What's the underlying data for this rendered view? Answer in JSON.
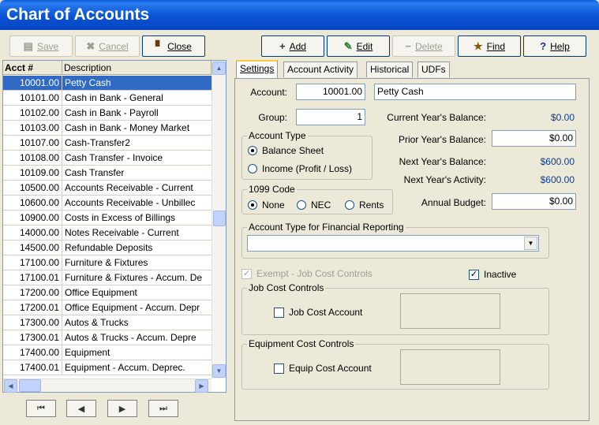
{
  "window": {
    "title": "Chart of Accounts"
  },
  "toolbar": {
    "save": "Save",
    "cancel": "Cancel",
    "close": "Close",
    "add": "Add",
    "edit": "Edit",
    "delete": "Delete",
    "find": "Find",
    "help": "Help"
  },
  "list": {
    "headers": [
      "Acct #",
      "Description"
    ],
    "rows": [
      {
        "acct": "10001.00",
        "desc": "Petty Cash"
      },
      {
        "acct": "10101.00",
        "desc": "Cash in Bank - General"
      },
      {
        "acct": "10102.00",
        "desc": "Cash in Bank - Payroll"
      },
      {
        "acct": "10103.00",
        "desc": "Cash in Bank - Money Market"
      },
      {
        "acct": "10107.00",
        "desc": "Cash-Transfer2"
      },
      {
        "acct": "10108.00",
        "desc": "Cash Transfer - Invoice"
      },
      {
        "acct": "10109.00",
        "desc": " Cash Transfer"
      },
      {
        "acct": "10500.00",
        "desc": "Accounts Receivable - Current"
      },
      {
        "acct": "10600.00",
        "desc": "Accounts Receivable - Unbillec"
      },
      {
        "acct": "10900.00",
        "desc": "Costs in Excess of Billings"
      },
      {
        "acct": "14000.00",
        "desc": "Notes Receivable - Current"
      },
      {
        "acct": "14500.00",
        "desc": "Refundable Deposits"
      },
      {
        "acct": "17100.00",
        "desc": "Furniture & Fixtures"
      },
      {
        "acct": "17100.01",
        "desc": "Furniture & Fixtures - Accum. De"
      },
      {
        "acct": "17200.00",
        "desc": "Office Equipment"
      },
      {
        "acct": "17200.01",
        "desc": "Office Equipment - Accum. Depr"
      },
      {
        "acct": "17300.00",
        "desc": "Autos & Trucks"
      },
      {
        "acct": "17300.01",
        "desc": "Autos & Trucks - Accum. Depre"
      },
      {
        "acct": "17400.00",
        "desc": "Equipment"
      },
      {
        "acct": "17400.01",
        "desc": "Equipment - Accum. Deprec."
      }
    ],
    "selected_index": 0
  },
  "tabs": [
    "Settings",
    "Account Activity",
    "Historical",
    "UDFs"
  ],
  "settings": {
    "account_label": "Account:",
    "account_number": "10001.00",
    "account_name": "Petty Cash",
    "group_label": "Group:",
    "group_value": "1",
    "current_year_label": "Current Year's Balance:",
    "current_year_value": "$0.00",
    "prior_year_label": "Prior Year's Balance:",
    "prior_year_value": "$0.00",
    "next_year_label": "Next Year's Balance:",
    "next_year_value": "$600.00",
    "next_year_activity_label": "Next Year's Activity:",
    "next_year_activity_value": "$600.00",
    "annual_budget_label": "Annual Budget:",
    "annual_budget_value": "$0.00",
    "account_type_legend": "Account Type",
    "account_type_options": [
      "Balance Sheet",
      "Income (Profit / Loss)"
    ],
    "code1099_legend": "1099 Code",
    "code1099_options": [
      "None",
      "NEC",
      "Rents"
    ],
    "financial_reporting_legend": "Account Type for Financial Reporting",
    "financial_reporting_value": "",
    "exempt_label": "Exempt - Job Cost Controls",
    "inactive_label": "Inactive",
    "job_cost_legend": "Job Cost Controls",
    "job_cost_account_label": "Job Cost Account",
    "equip_cost_legend": "Equipment Cost Controls",
    "equip_cost_account_label": "Equip Cost Account"
  },
  "colors": {
    "title_bar": "#0a52d4",
    "selection": "#316ac5",
    "value_text": "#0b3d91",
    "active_tab_accent": "#ffc83c"
  }
}
